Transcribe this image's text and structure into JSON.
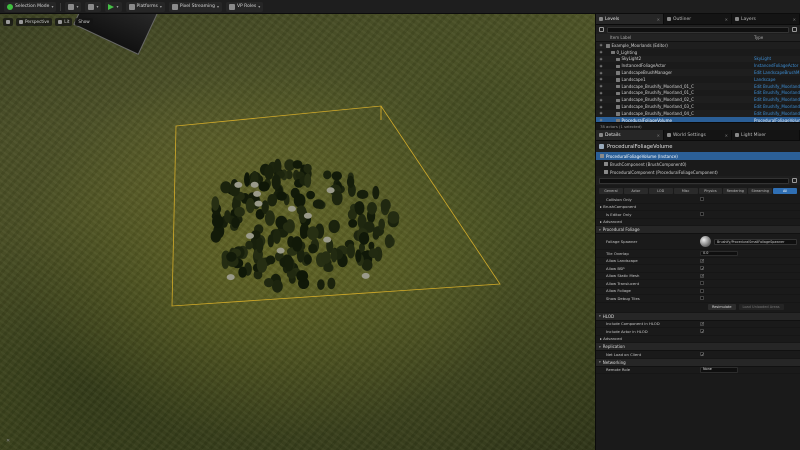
{
  "toolbar": {
    "items": [
      {
        "label": "Selection Mode",
        "icon": "select-icon"
      },
      {
        "label": "",
        "icon": "mode-icon"
      },
      {
        "label": "",
        "icon": "build-icon"
      },
      {
        "label": "",
        "icon": "play-icon"
      },
      {
        "label": "Platforms",
        "icon": "platforms-icon"
      },
      {
        "label": "Pixel Streaming",
        "icon": "pixel-streaming-icon"
      },
      {
        "label": "VP Roles",
        "icon": "vp-roles-icon"
      }
    ]
  },
  "viewport": {
    "chips": [
      "Perspective",
      "Lit",
      "Show"
    ]
  },
  "outliner": {
    "tabs": [
      {
        "label": "Levels",
        "active": true
      },
      {
        "label": "Outliner",
        "active": false
      },
      {
        "label": "Layers",
        "active": false
      }
    ],
    "search_placeholder": "Search...",
    "columns": {
      "label": "Item Label",
      "type": "Type"
    },
    "rows": [
      {
        "label": "Example_Moorlands (Editor)",
        "type": "",
        "indent": 0,
        "selected": false
      },
      {
        "label": "0_Lighting",
        "type": "",
        "indent": 1,
        "selected": false
      },
      {
        "label": "SkyLight2",
        "type": "SkyLight",
        "indent": 2,
        "selected": false
      },
      {
        "label": "InstancedFoliageActor",
        "type": "InstancedFoliageActor",
        "indent": 2,
        "selected": false
      },
      {
        "label": "LandscapeBrushManager",
        "type": "Edit LandscapeBrushM",
        "indent": 2,
        "selected": false
      },
      {
        "label": "Landscape1",
        "type": "Landscape",
        "indent": 2,
        "selected": false
      },
      {
        "label": "Landscape_Brushify_Moorland_01_C",
        "type": "Edit Brushify_Moorland",
        "indent": 2,
        "selected": false
      },
      {
        "label": "Landscape_Brushify_Moorland_01_C",
        "type": "Edit Brushify_Moorland",
        "indent": 2,
        "selected": false
      },
      {
        "label": "Landscape_Brushify_Moorland_02_C",
        "type": "Edit Brushify_Moorland",
        "indent": 2,
        "selected": false
      },
      {
        "label": "Landscape_Brushify_Moorland_03_C",
        "type": "Edit Brushify_Moorland",
        "indent": 2,
        "selected": false
      },
      {
        "label": "Landscape_Brushify_Moorland_04_C",
        "type": "Edit Brushify_Moorland",
        "indent": 2,
        "selected": false
      },
      {
        "label": "ProceduralFoliageVolume",
        "type": "ProceduralFoliageVolume",
        "indent": 2,
        "selected": true
      }
    ],
    "status": "78 actors (1 selected)"
  },
  "details": {
    "tabs": [
      {
        "label": "Details",
        "active": true
      },
      {
        "label": "World Settings",
        "active": false
      },
      {
        "label": "Light Mixer",
        "active": false
      }
    ],
    "title": "ProceduralFoliageVolume",
    "components": [
      {
        "label": "ProceduralFoliageVolume (Instance)",
        "selected": true
      },
      {
        "label": "BrushComponent (BrushComponent0)",
        "selected": false
      },
      {
        "label": "ProceduralComponent (ProceduralFoliageComponent)",
        "selected": false
      }
    ],
    "categories": [
      "General",
      "Actor",
      "LOD",
      "Misc",
      "Physics",
      "Rendering",
      "Streaming",
      "All"
    ],
    "props_top": [
      {
        "name": "Collision Only",
        "check": false
      },
      {
        "name": "BrushComponent",
        "section": true
      },
      {
        "name": "Is Editor Only",
        "check": false
      },
      {
        "name": "Advanced",
        "section": true
      }
    ],
    "pf_section": "Procedural Foliage",
    "foliage_spawner_label": "Foliage Spawner",
    "foliage_spawner_value": "Brushify/ProceduralSmallFoliageSpawner",
    "tile_overlap_label": "Tile Overlap",
    "tile_overlap_value": "0.0",
    "pf_checks": [
      {
        "name": "Allow Landscape",
        "check": true
      },
      {
        "name": "Allow BSP",
        "check": true
      },
      {
        "name": "Allow Static Mesh",
        "check": true
      },
      {
        "name": "Allow Translucent",
        "check": false
      },
      {
        "name": "Allow Foliage",
        "check": false
      },
      {
        "name": "Show Debug Tiles",
        "check": false
      }
    ],
    "resimulate": "Resimulate",
    "load_unloaded": "Load Unloaded Areas",
    "hlod_section": "HLOD",
    "hlod_checks": [
      {
        "name": "Include Component in HLOD",
        "check": true
      },
      {
        "name": "Include Actor in HLOD",
        "check": true
      }
    ],
    "advanced_2": "Advanced",
    "replication_section": "Replication",
    "net_load_on_client": "Net Load on Client",
    "networking_section": "Networking",
    "remote_role_label": "Remote Role",
    "remote_role_value": "None"
  },
  "colors": {
    "accent": "#2f6fb4",
    "selection": "#2b5f97",
    "bounds": "#e0b42a"
  }
}
